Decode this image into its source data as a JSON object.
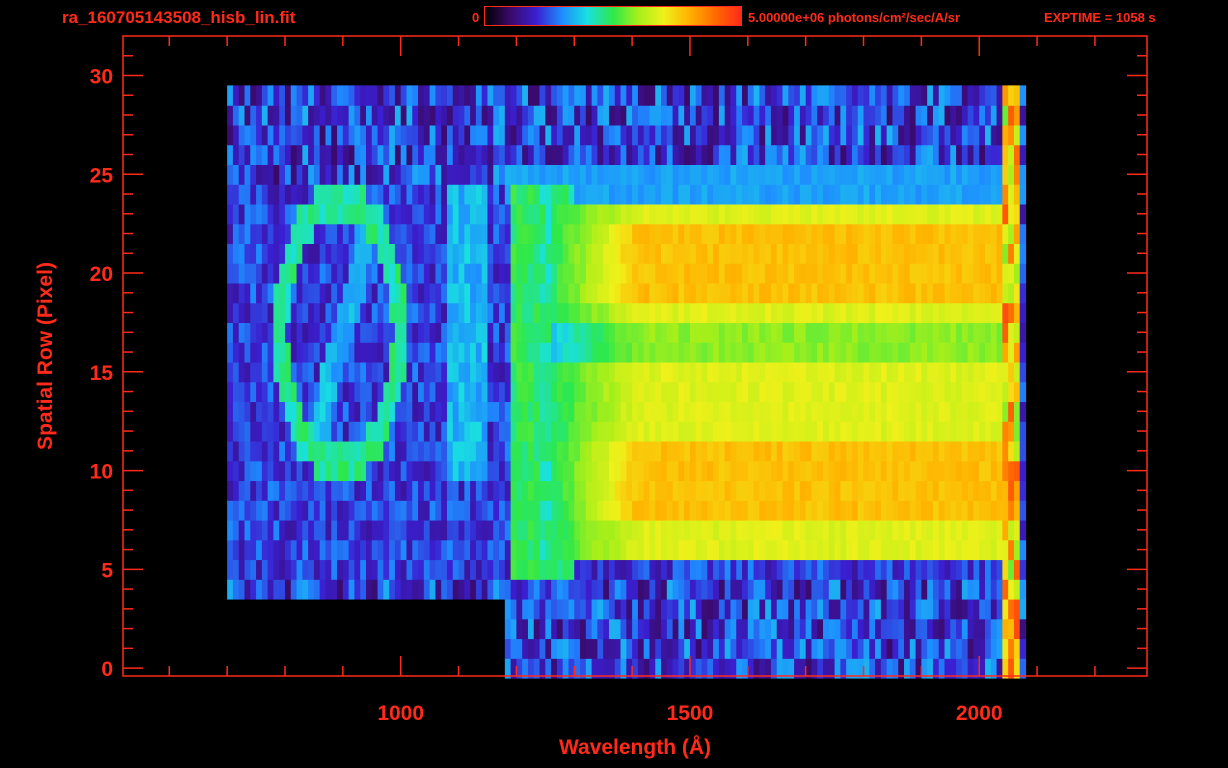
{
  "header": {
    "file_title": "ra_160705143508_hisb_lin.fit",
    "colorbar_min": "0",
    "colorbar_max": "5.00000e+06 photons/cm²/sec/A/sr",
    "exptime": "EXPTIME = 1058 s"
  },
  "colors": {
    "axis": "#ff2a1a",
    "background": "#000000",
    "colormap": [
      "#000000",
      "#3a0a6a",
      "#3a1fd0",
      "#1e8cff",
      "#19e0e0",
      "#2ee84a",
      "#a8ef1a",
      "#f0f01a",
      "#ffb000",
      "#ff6a00",
      "#ff2a1a"
    ]
  },
  "chart_data": {
    "type": "heatmap",
    "title": "ra_160705143508_hisb_lin.fit",
    "xlabel": "Wavelength (Å)",
    "ylabel": "Spatial Row (Pixel)",
    "xlim": [
      520,
      2290
    ],
    "ylim": [
      -0.4,
      32
    ],
    "x_ticks": [
      1000,
      1500,
      2000
    ],
    "y_ticks": [
      0,
      5,
      10,
      15,
      20,
      25,
      30
    ],
    "colorbar": {
      "min": 0,
      "max": 5000000,
      "units": "photons/cm²/sec/A/sr"
    },
    "data_extent": {
      "x_min": 700,
      "x_max": 2075,
      "y_min": 0,
      "y_max": 30
    },
    "bright_region": {
      "x_min": 1260,
      "x_max": 2060,
      "y_min": 6,
      "y_max": 23,
      "level": 0.65
    },
    "lyman_alpha_line": {
      "x": 1216,
      "y_min": 5,
      "y_max": 24,
      "level": 0.45
    },
    "wavy_feature": {
      "x_center": 905,
      "y_range": [
        10,
        24
      ],
      "level": 0.4
    }
  }
}
